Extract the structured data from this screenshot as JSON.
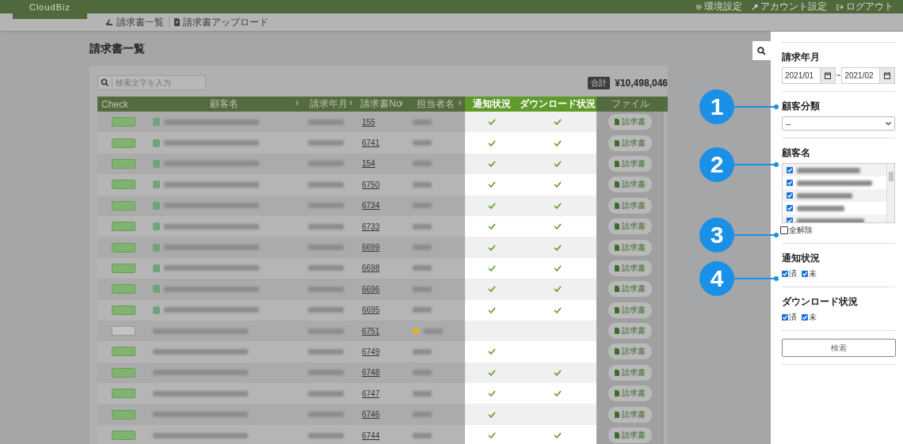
{
  "header": {
    "logo": "CloudBiz",
    "links": [
      {
        "label": "環境設定",
        "kind": "gear"
      },
      {
        "label": "アカウント設定",
        "kind": "key"
      },
      {
        "label": "ログアウト",
        "kind": "logout"
      }
    ]
  },
  "subnav": [
    {
      "label": "請求書一覧",
      "kind": "list"
    },
    {
      "label": "請求書アップロード",
      "kind": "file"
    }
  ],
  "page_title": "請求書一覧",
  "search": {
    "placeholder": "検索文字を入力"
  },
  "total": {
    "label": "合計",
    "amount": "¥10,498,046"
  },
  "table": {
    "columns": [
      {
        "label": "Check",
        "sortable": false,
        "highlighted": false
      },
      {
        "label": "顧客名",
        "sortable": true,
        "highlighted": false
      },
      {
        "label": "請求年月",
        "sortable": true,
        "highlighted": false
      },
      {
        "label": "請求書No",
        "sortable": true,
        "highlighted": false
      },
      {
        "label": "担当者名",
        "sortable": true,
        "highlighted": false
      },
      {
        "label": "通知状況",
        "sortable": false,
        "highlighted": true
      },
      {
        "label": "ダウンロード状況",
        "sortable": false,
        "highlighted": true
      },
      {
        "label": "ファイル",
        "sortable": false,
        "highlighted": false
      }
    ],
    "rows": [
      {
        "no": "155",
        "checked": true,
        "doc_icon": true,
        "warning": false,
        "notified": true,
        "downloaded": true,
        "file": "請求書"
      },
      {
        "no": "6741",
        "checked": true,
        "doc_icon": true,
        "warning": false,
        "notified": true,
        "downloaded": true,
        "file": "請求書"
      },
      {
        "no": "154",
        "checked": true,
        "doc_icon": true,
        "warning": false,
        "notified": true,
        "downloaded": true,
        "file": "請求書"
      },
      {
        "no": "6750",
        "checked": true,
        "doc_icon": true,
        "warning": false,
        "notified": true,
        "downloaded": true,
        "file": "請求書"
      },
      {
        "no": "6734",
        "checked": true,
        "doc_icon": true,
        "warning": false,
        "notified": true,
        "downloaded": true,
        "file": "請求書"
      },
      {
        "no": "6733",
        "checked": true,
        "doc_icon": true,
        "warning": false,
        "notified": true,
        "downloaded": true,
        "file": "請求書"
      },
      {
        "no": "6699",
        "checked": true,
        "doc_icon": true,
        "warning": false,
        "notified": true,
        "downloaded": true,
        "file": "請求書"
      },
      {
        "no": "6698",
        "checked": true,
        "doc_icon": true,
        "warning": false,
        "notified": true,
        "downloaded": true,
        "file": "請求書"
      },
      {
        "no": "6696",
        "checked": true,
        "doc_icon": true,
        "warning": false,
        "notified": true,
        "downloaded": true,
        "file": "請求書"
      },
      {
        "no": "6695",
        "checked": true,
        "doc_icon": true,
        "warning": false,
        "notified": true,
        "downloaded": true,
        "file": "請求書"
      },
      {
        "no": "6751",
        "checked": false,
        "doc_icon": false,
        "warning": true,
        "notified": false,
        "downloaded": false,
        "file": "請求書"
      },
      {
        "no": "6749",
        "checked": true,
        "doc_icon": false,
        "warning": false,
        "notified": true,
        "downloaded": false,
        "file": "請求書"
      },
      {
        "no": "6748",
        "checked": true,
        "doc_icon": false,
        "warning": false,
        "notified": true,
        "downloaded": true,
        "file": "請求書"
      },
      {
        "no": "6747",
        "checked": true,
        "doc_icon": false,
        "warning": false,
        "notified": true,
        "downloaded": true,
        "file": "請求書"
      },
      {
        "no": "6746",
        "checked": true,
        "doc_icon": false,
        "warning": false,
        "notified": true,
        "downloaded": false,
        "file": "請求書"
      },
      {
        "no": "6744",
        "checked": true,
        "doc_icon": false,
        "warning": false,
        "notified": true,
        "downloaded": true,
        "file": "請求書"
      }
    ]
  },
  "filter_panel": {
    "date": {
      "label": "請求年月",
      "from": "2021/01",
      "separator": "~",
      "to": "2021/02"
    },
    "category": {
      "label": "顧客分類",
      "value": "--"
    },
    "customers": {
      "label": "顧客名",
      "items": [
        {
          "checked": true
        },
        {
          "checked": true
        },
        {
          "checked": true
        },
        {
          "checked": true
        },
        {
          "checked": true
        }
      ]
    },
    "clear_all": {
      "label": "全解除",
      "checked": false
    },
    "notify": {
      "label": "通知状況",
      "options": [
        {
          "label": "済",
          "checked": true
        },
        {
          "label": "未",
          "checked": true
        }
      ]
    },
    "download": {
      "label": "ダウンロード状況",
      "options": [
        {
          "label": "済",
          "checked": true
        },
        {
          "label": "未",
          "checked": true
        }
      ]
    },
    "search_button": "検索"
  },
  "callouts": [
    {
      "number": "1"
    },
    {
      "number": "2"
    },
    {
      "number": "3"
    },
    {
      "number": "4"
    }
  ]
}
